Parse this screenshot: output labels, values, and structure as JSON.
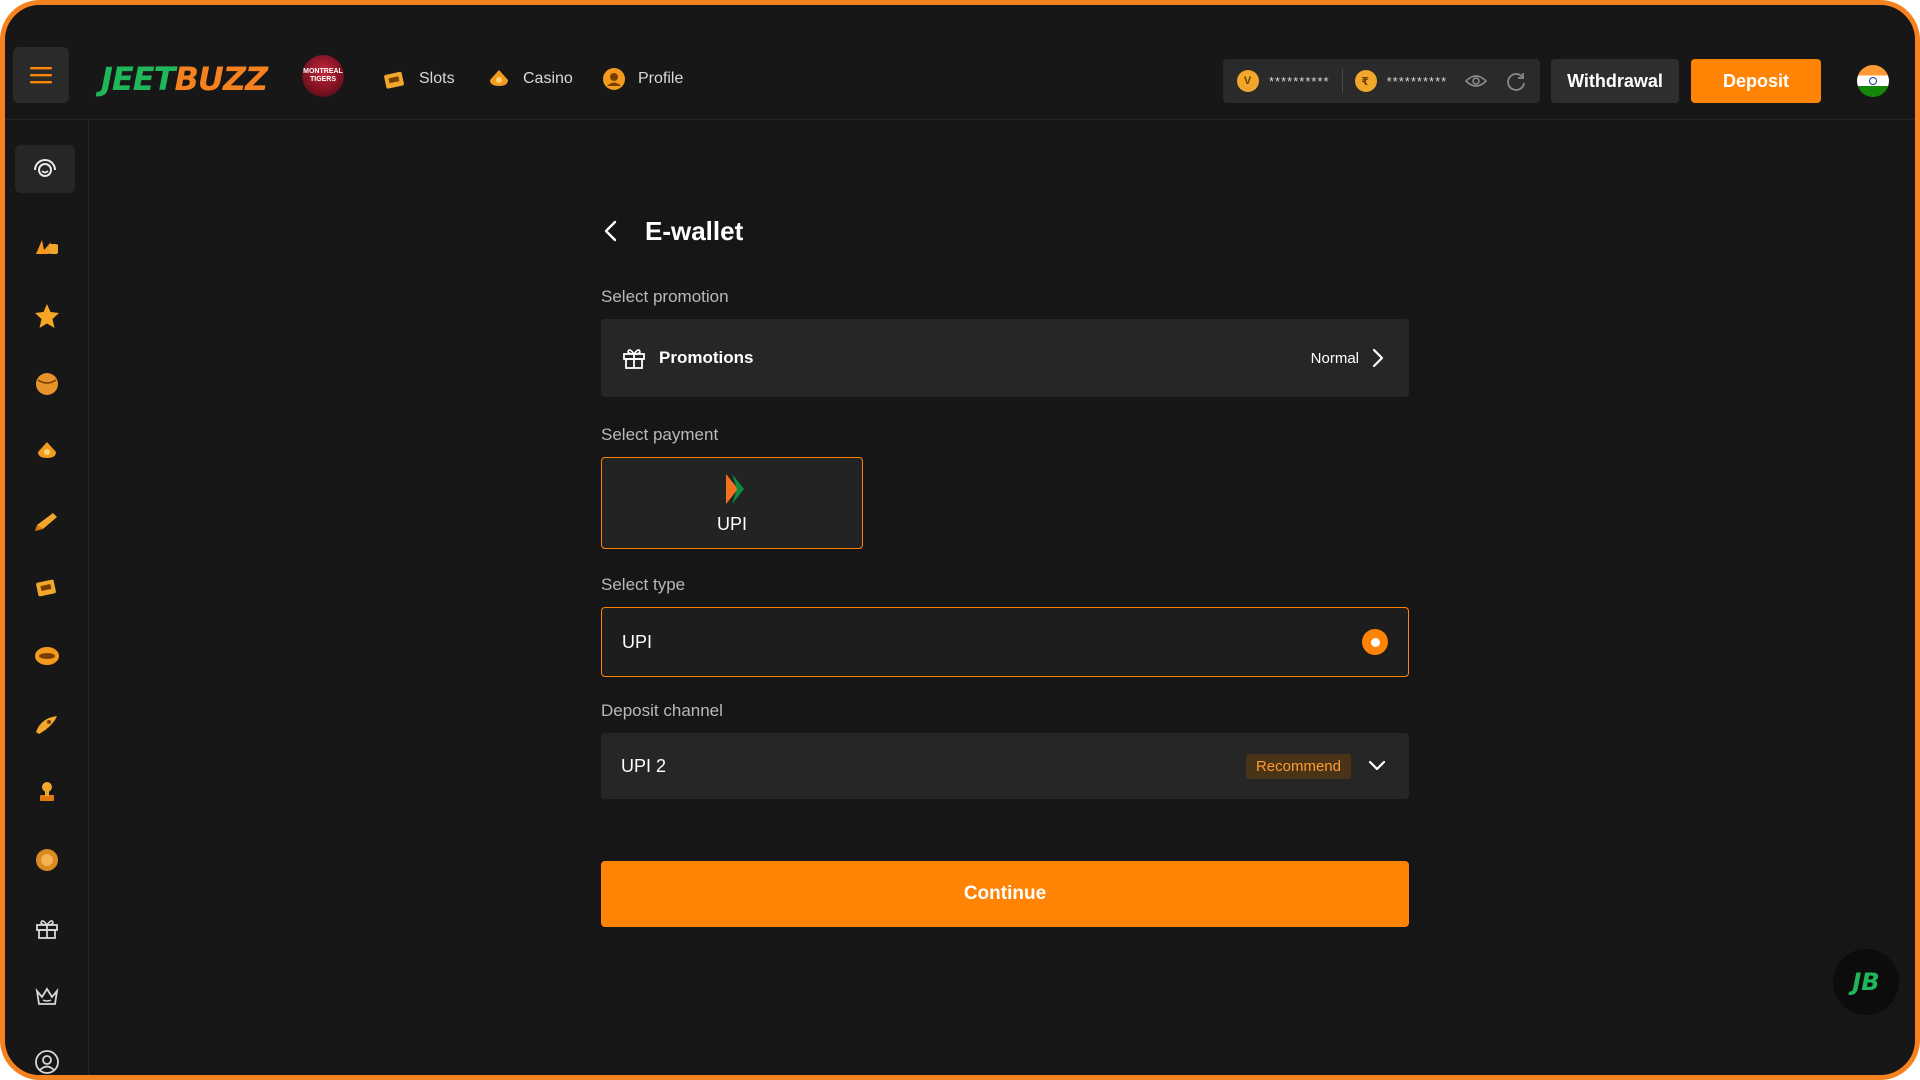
{
  "header": {
    "logo_part1": "JEET",
    "logo_part2": "BUZZ",
    "team_badge_text": "MONTREAL TIGERS",
    "nav": [
      {
        "label": "Slots",
        "icon": "slots-icon"
      },
      {
        "label": "Casino",
        "icon": "casino-icon"
      },
      {
        "label": "Profile",
        "icon": "profile-icon"
      }
    ],
    "balance_main": "**********",
    "balance_secondary": "**********",
    "withdrawal_label": "Withdrawal",
    "deposit_label": "Deposit",
    "region_flag": "india-flag-icon"
  },
  "sidebar": {
    "items": [
      "support-icon",
      "jb-icon",
      "star-icon",
      "sports-ball-icon",
      "casino-spade-icon",
      "fish-icon",
      "slots-icon",
      "table-game-icon",
      "crash-rocket-icon",
      "lottery-icon",
      "coin-icon",
      "gift-icon",
      "vip-crown-icon",
      "referral-icon"
    ]
  },
  "main": {
    "title": "E-wallet",
    "promotion_label": "Select promotion",
    "promotions_title": "Promotions",
    "promotions_value": "Normal",
    "payment_label": "Select payment",
    "payment_option": "UPI",
    "type_label": "Select type",
    "type_option": "UPI",
    "channel_label": "Deposit channel",
    "channel_value": "UPI 2",
    "channel_badge": "Recommend",
    "continue_label": "Continue"
  },
  "float_button": "JB",
  "colors": {
    "accent": "#ff8304",
    "background": "#161616",
    "card": "#262626",
    "frame_border": "#f5821f"
  }
}
